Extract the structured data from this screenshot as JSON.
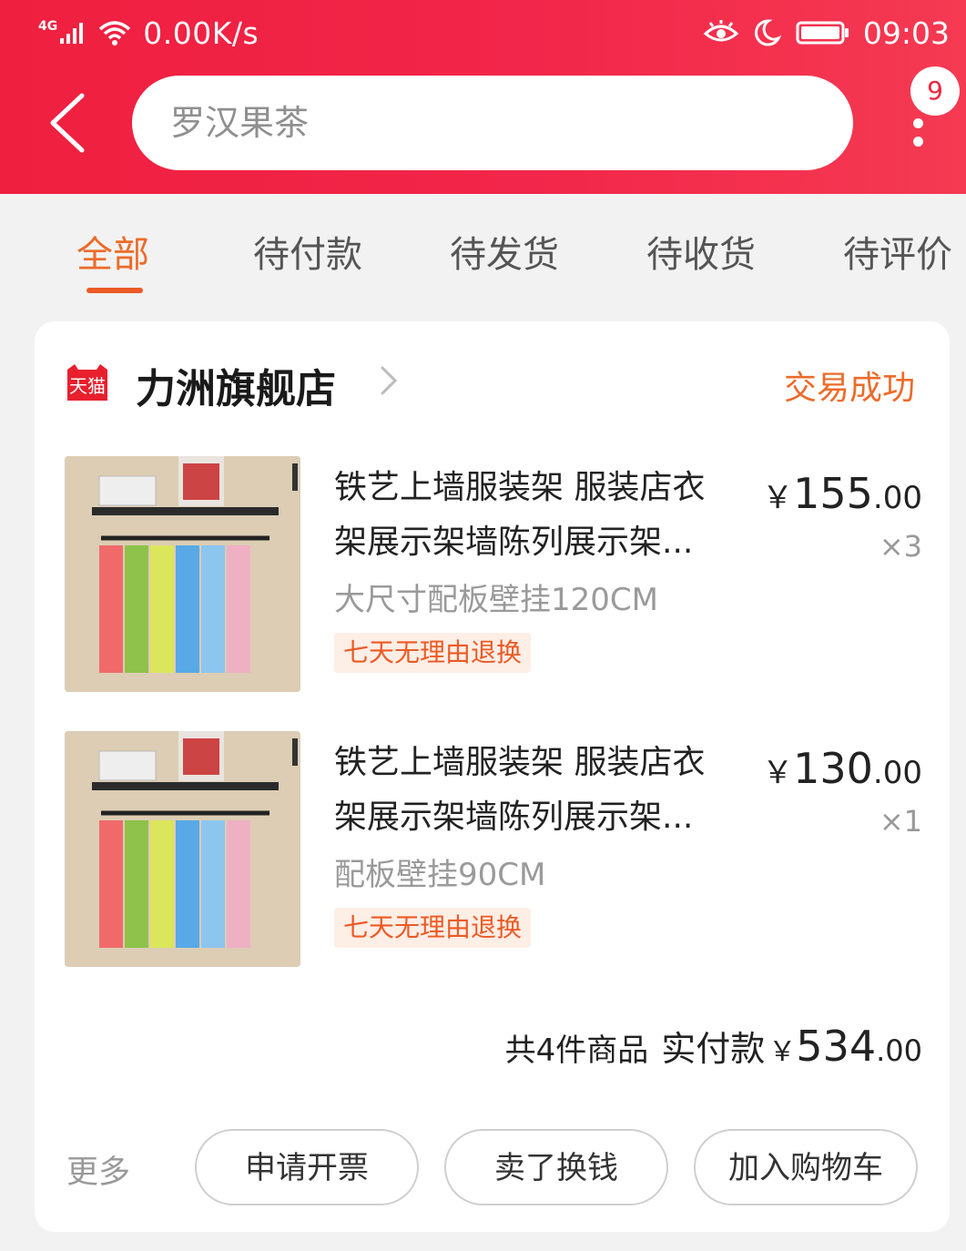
{
  "status_bar": {
    "network": "4G",
    "speed": "0.00K/s",
    "time": "09:03"
  },
  "header": {
    "search_text": "罗汉果茶",
    "badge_count": "9"
  },
  "tabs": [
    {
      "label": "全部",
      "active": true
    },
    {
      "label": "待付款",
      "active": false
    },
    {
      "label": "待发货",
      "active": false
    },
    {
      "label": "待收货",
      "active": false
    },
    {
      "label": "待评价",
      "active": false
    }
  ],
  "order": {
    "shop_badge": "天猫",
    "shop_name": "力洲旗舰店",
    "status": "交易成功",
    "items": [
      {
        "title_line1": "铁艺上墙服装架 服装店衣",
        "title_line2": "架展示架墙陈列展示架...",
        "sku": "大尺寸配板壁挂120CM",
        "tag": "七天无理由退换",
        "currency": "￥",
        "price_int": "155",
        "price_dec": ".00",
        "qty": "×3"
      },
      {
        "title_line1": "铁艺上墙服装架 服装店衣",
        "title_line2": "架展示架墙陈列展示架...",
        "sku": "配板壁挂90CM",
        "tag": "七天无理由退换",
        "currency": "￥",
        "price_int": "130",
        "price_dec": ".00",
        "qty": "×1"
      }
    ],
    "summary": {
      "count_text": "共4件商品",
      "paid_label": "实付款",
      "currency": "￥",
      "total_int": "534",
      "total_dec": ".00"
    },
    "actions": {
      "more": "更多",
      "invoice": "申请开票",
      "sell": "卖了换钱",
      "add_cart": "加入购物车"
    }
  },
  "colors": {
    "header_red": "#f0243f",
    "accent_orange": "#ec6b2a"
  }
}
